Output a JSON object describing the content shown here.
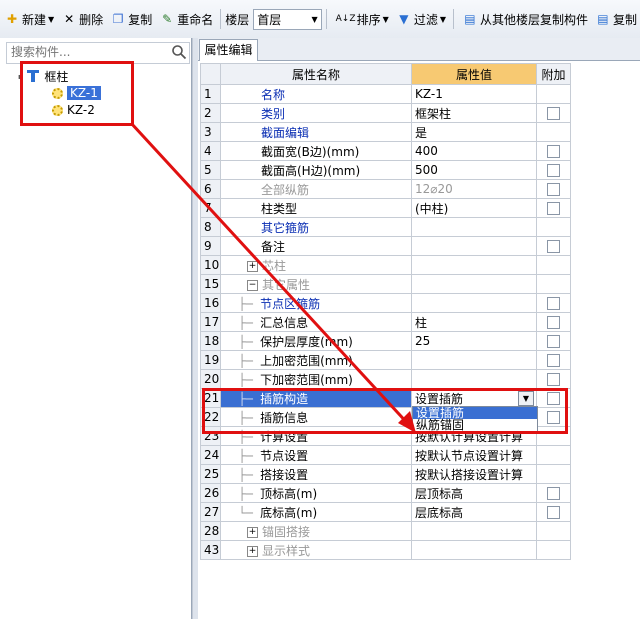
{
  "colors": {
    "annotation": "#e01010",
    "selection": "#3a6fd2",
    "value_header": "#f7c972"
  },
  "toolbar": {
    "new_label": "新建",
    "delete_label": "删除",
    "copy_label": "复制",
    "rename_label": "重命名",
    "floor_label": "楼层",
    "floor_value": "首层",
    "sort_label": "排序",
    "filter_label": "过滤",
    "copy_from_floor_label": "从其他楼层复制构件",
    "copy_to_label": "复制"
  },
  "left": {
    "search_placeholder": "搜索构件...",
    "tree": {
      "root": "框柱",
      "children": [
        "KZ-1",
        "KZ-2"
      ]
    }
  },
  "right": {
    "tab_label": "属性编辑",
    "headers": {
      "name": "属性名称",
      "value": "属性值",
      "extra": "附加"
    },
    "rows": [
      {
        "num": "1",
        "name": "名称",
        "value": "KZ-1"
      },
      {
        "num": "2",
        "name": "类别",
        "value": "框架柱"
      },
      {
        "num": "3",
        "name": "截面编辑",
        "value": "是"
      },
      {
        "num": "4",
        "name": "截面宽(B边)(mm)",
        "value": "400"
      },
      {
        "num": "5",
        "name": "截面高(H边)(mm)",
        "value": "500"
      },
      {
        "num": "6",
        "name": "全部纵筋",
        "value": "12⌀20"
      },
      {
        "num": "7",
        "name": "柱类型",
        "value": "(中柱)"
      },
      {
        "num": "8",
        "name": "其它箍筋",
        "value": ""
      },
      {
        "num": "9",
        "name": "备注",
        "value": ""
      },
      {
        "num": "10",
        "name": "芯柱",
        "value": ""
      },
      {
        "num": "15",
        "name": "其它属性",
        "value": ""
      },
      {
        "num": "16",
        "name": "节点区箍筋",
        "value": ""
      },
      {
        "num": "17",
        "name": "汇总信息",
        "value": "柱"
      },
      {
        "num": "18",
        "name": "保护层厚度(mm)",
        "value": "25"
      },
      {
        "num": "19",
        "name": "上加密范围(mm)",
        "value": ""
      },
      {
        "num": "20",
        "name": "下加密范围(mm)",
        "value": ""
      },
      {
        "num": "21",
        "name": "插筋构造",
        "value": "设置插筋"
      },
      {
        "num": "22",
        "name": "插筋信息",
        "value": ""
      },
      {
        "num": "23",
        "name": "计算设置",
        "value": "按默认计算设置计算"
      },
      {
        "num": "24",
        "name": "节点设置",
        "value": "按默认节点设置计算"
      },
      {
        "num": "25",
        "name": "搭接设置",
        "value": "按默认搭接设置计算"
      },
      {
        "num": "26",
        "name": "顶标高(m)",
        "value": "层顶标高"
      },
      {
        "num": "27",
        "name": "底标高(m)",
        "value": "层底标高"
      },
      {
        "num": "28",
        "name": "锚固搭接",
        "value": ""
      },
      {
        "num": "43",
        "name": "显示样式",
        "value": ""
      }
    ],
    "dropdown_options": [
      "设置插筋",
      "纵筋锚固"
    ]
  }
}
